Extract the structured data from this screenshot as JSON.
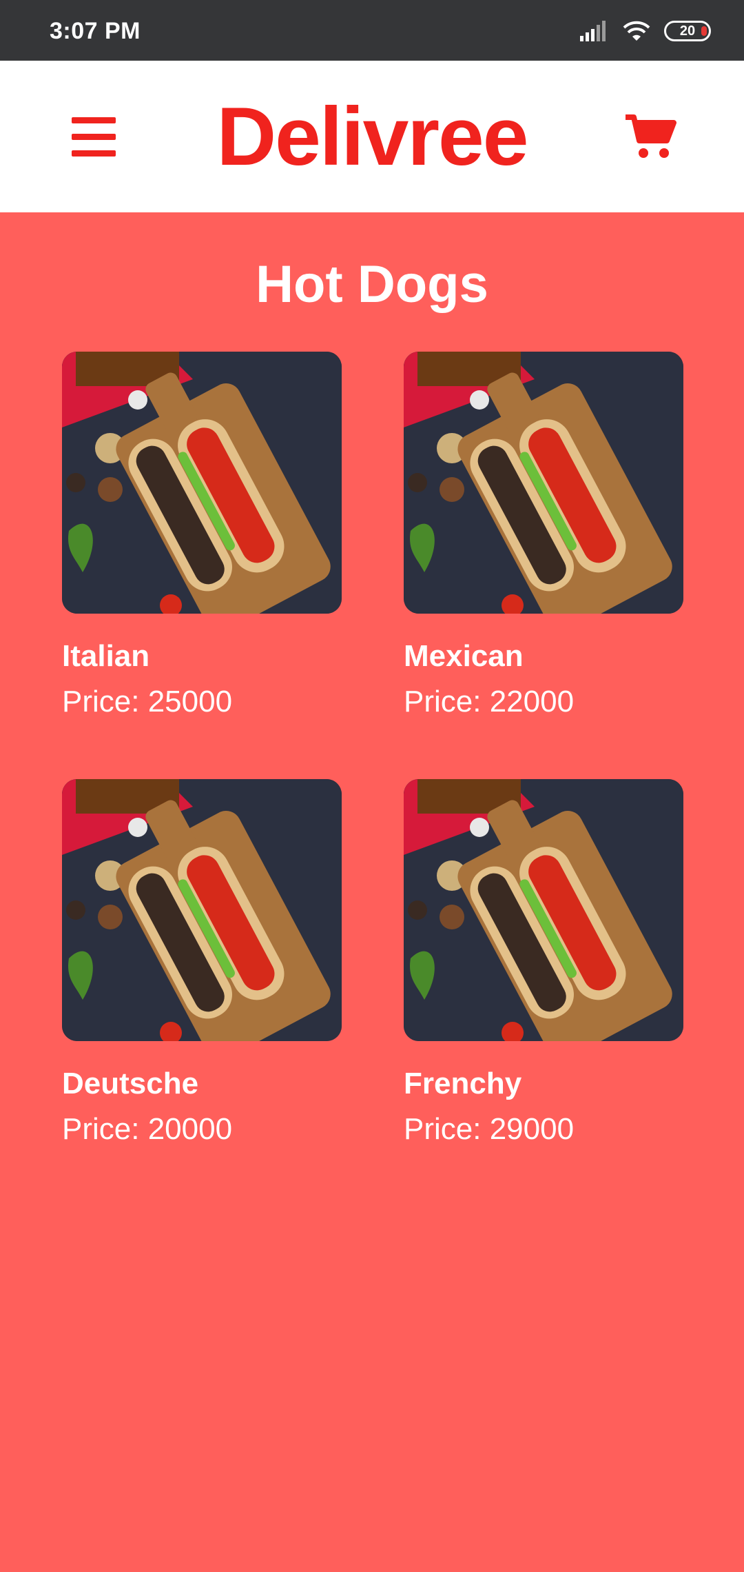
{
  "status_bar": {
    "time": "3:07 PM",
    "battery": "20",
    "icons": [
      "signal-icon",
      "wifi-icon",
      "battery-icon"
    ]
  },
  "header": {
    "brand": "Delivree",
    "menu_icon": "hamburger-menu-icon",
    "cart_icon": "shopping-cart-icon"
  },
  "colors": {
    "brand_red": "#F0231E",
    "background": "#FF5F5B",
    "status_bar": "#353638"
  },
  "category": {
    "title": "Hot Dogs"
  },
  "products": [
    {
      "name": "Italian",
      "price": "Price: 25000"
    },
    {
      "name": "Mexican",
      "price": "Price: 22000"
    },
    {
      "name": "Deutsche",
      "price": "Price: 20000"
    },
    {
      "name": "Frenchy",
      "price": "Price: 29000"
    }
  ]
}
